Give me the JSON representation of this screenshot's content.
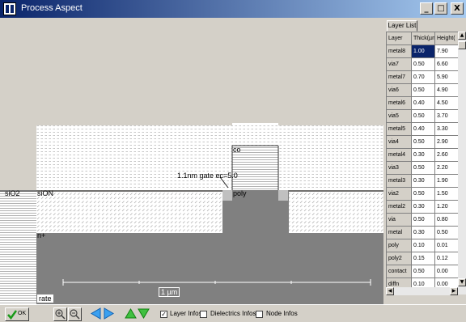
{
  "window": {
    "title": "Process Aspect",
    "min_glyph": "_",
    "max_glyph": "□",
    "close_glyph": "X"
  },
  "canvas": {
    "labels": {
      "sio2": "siO2",
      "sion": "siON",
      "nplus": "n+",
      "co": "co",
      "poly": "poly",
      "gate": "1.1nm gate ec=5.0",
      "scale": "1 µm",
      "substrate": "rate"
    },
    "colors": {
      "substrate": "#808080",
      "dielectric": "#ffffff",
      "background": "#d4d0c8"
    }
  },
  "layer_panel": {
    "tab_label": "Layer List",
    "columns": [
      "Layer",
      "Thick(µm)",
      "Height("
    ],
    "rows": [
      [
        "metal8",
        "1.00",
        "7.90"
      ],
      [
        "via7",
        "0.50",
        "6.60"
      ],
      [
        "metal7",
        "0.70",
        "5.90"
      ],
      [
        "via6",
        "0.50",
        "4.90"
      ],
      [
        "metal6",
        "0.40",
        "4.50"
      ],
      [
        "via5",
        "0.50",
        "3.70"
      ],
      [
        "metal5",
        "0.40",
        "3.30"
      ],
      [
        "via4",
        "0.50",
        "2.90"
      ],
      [
        "metal4",
        "0.30",
        "2.60"
      ],
      [
        "via3",
        "0.50",
        "2.20"
      ],
      [
        "metal3",
        "0.30",
        "1.90"
      ],
      [
        "via2",
        "0.50",
        "1.50"
      ],
      [
        "metal2",
        "0.30",
        "1.20"
      ],
      [
        "via",
        "0.50",
        "0.80"
      ],
      [
        "metal",
        "0.30",
        "0.50"
      ],
      [
        "poly",
        "0.10",
        "0.01"
      ],
      [
        "poly2",
        "0.15",
        "0.12"
      ],
      [
        "contact",
        "0.50",
        "0.00"
      ],
      [
        "diffn",
        "0.10",
        "0.00"
      ],
      [
        "diffp",
        "0.10",
        "0.00"
      ]
    ],
    "selected": {
      "row": 0,
      "col": 1
    }
  },
  "toolbar": {
    "ok_label": "OK",
    "layer_infos": {
      "label": "Layer Infos",
      "checked": true
    },
    "dielectrics_infos": {
      "label": "Dielectrics Infos",
      "checked": false
    },
    "node_infos": {
      "label": "Node Infos",
      "checked": false
    },
    "icons": [
      "ok-icon",
      "zoom-in-icon",
      "zoom-out-icon",
      "arrow-left-icon",
      "arrow-right-icon",
      "arrow-up-icon",
      "arrow-down-icon"
    ]
  }
}
